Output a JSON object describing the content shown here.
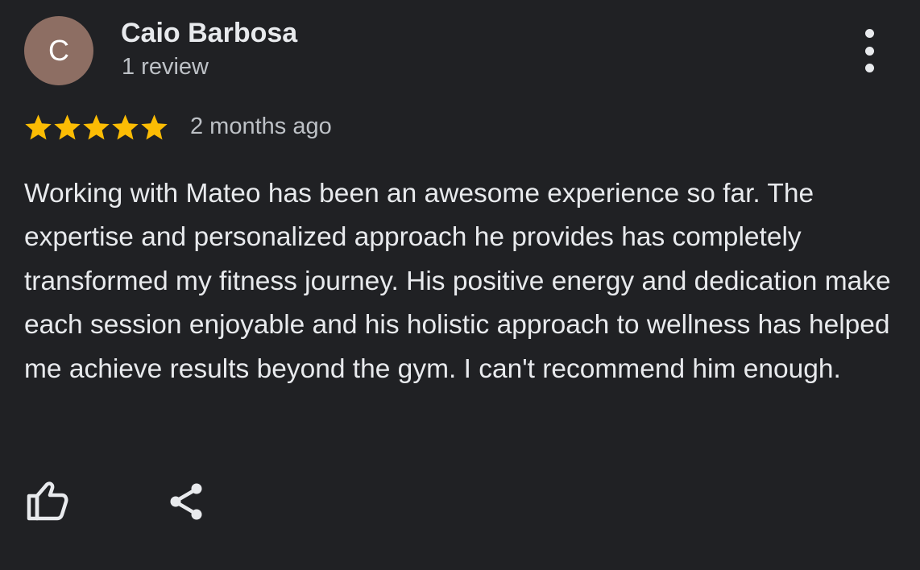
{
  "reviewer": {
    "initial": "C",
    "name": "Caio Barbosa",
    "review_count": "1 review",
    "avatar_color": "#8d6e63"
  },
  "review": {
    "rating": 5,
    "max_rating": 5,
    "star_color": "#fbbc04",
    "time": "2 months ago",
    "text": "Working with Mateo has been an awesome experience so far. The expertise and personalized approach he provides has completely transformed my fitness journey. His positive energy and dedication make each session enjoyable and his holistic approach to wellness has helped me achieve results beyond the gym. I can't recommend him enough."
  },
  "icons": {
    "menu": "more-vert-icon",
    "like": "thumbs-up-icon",
    "share": "share-icon",
    "star": "star-icon"
  }
}
